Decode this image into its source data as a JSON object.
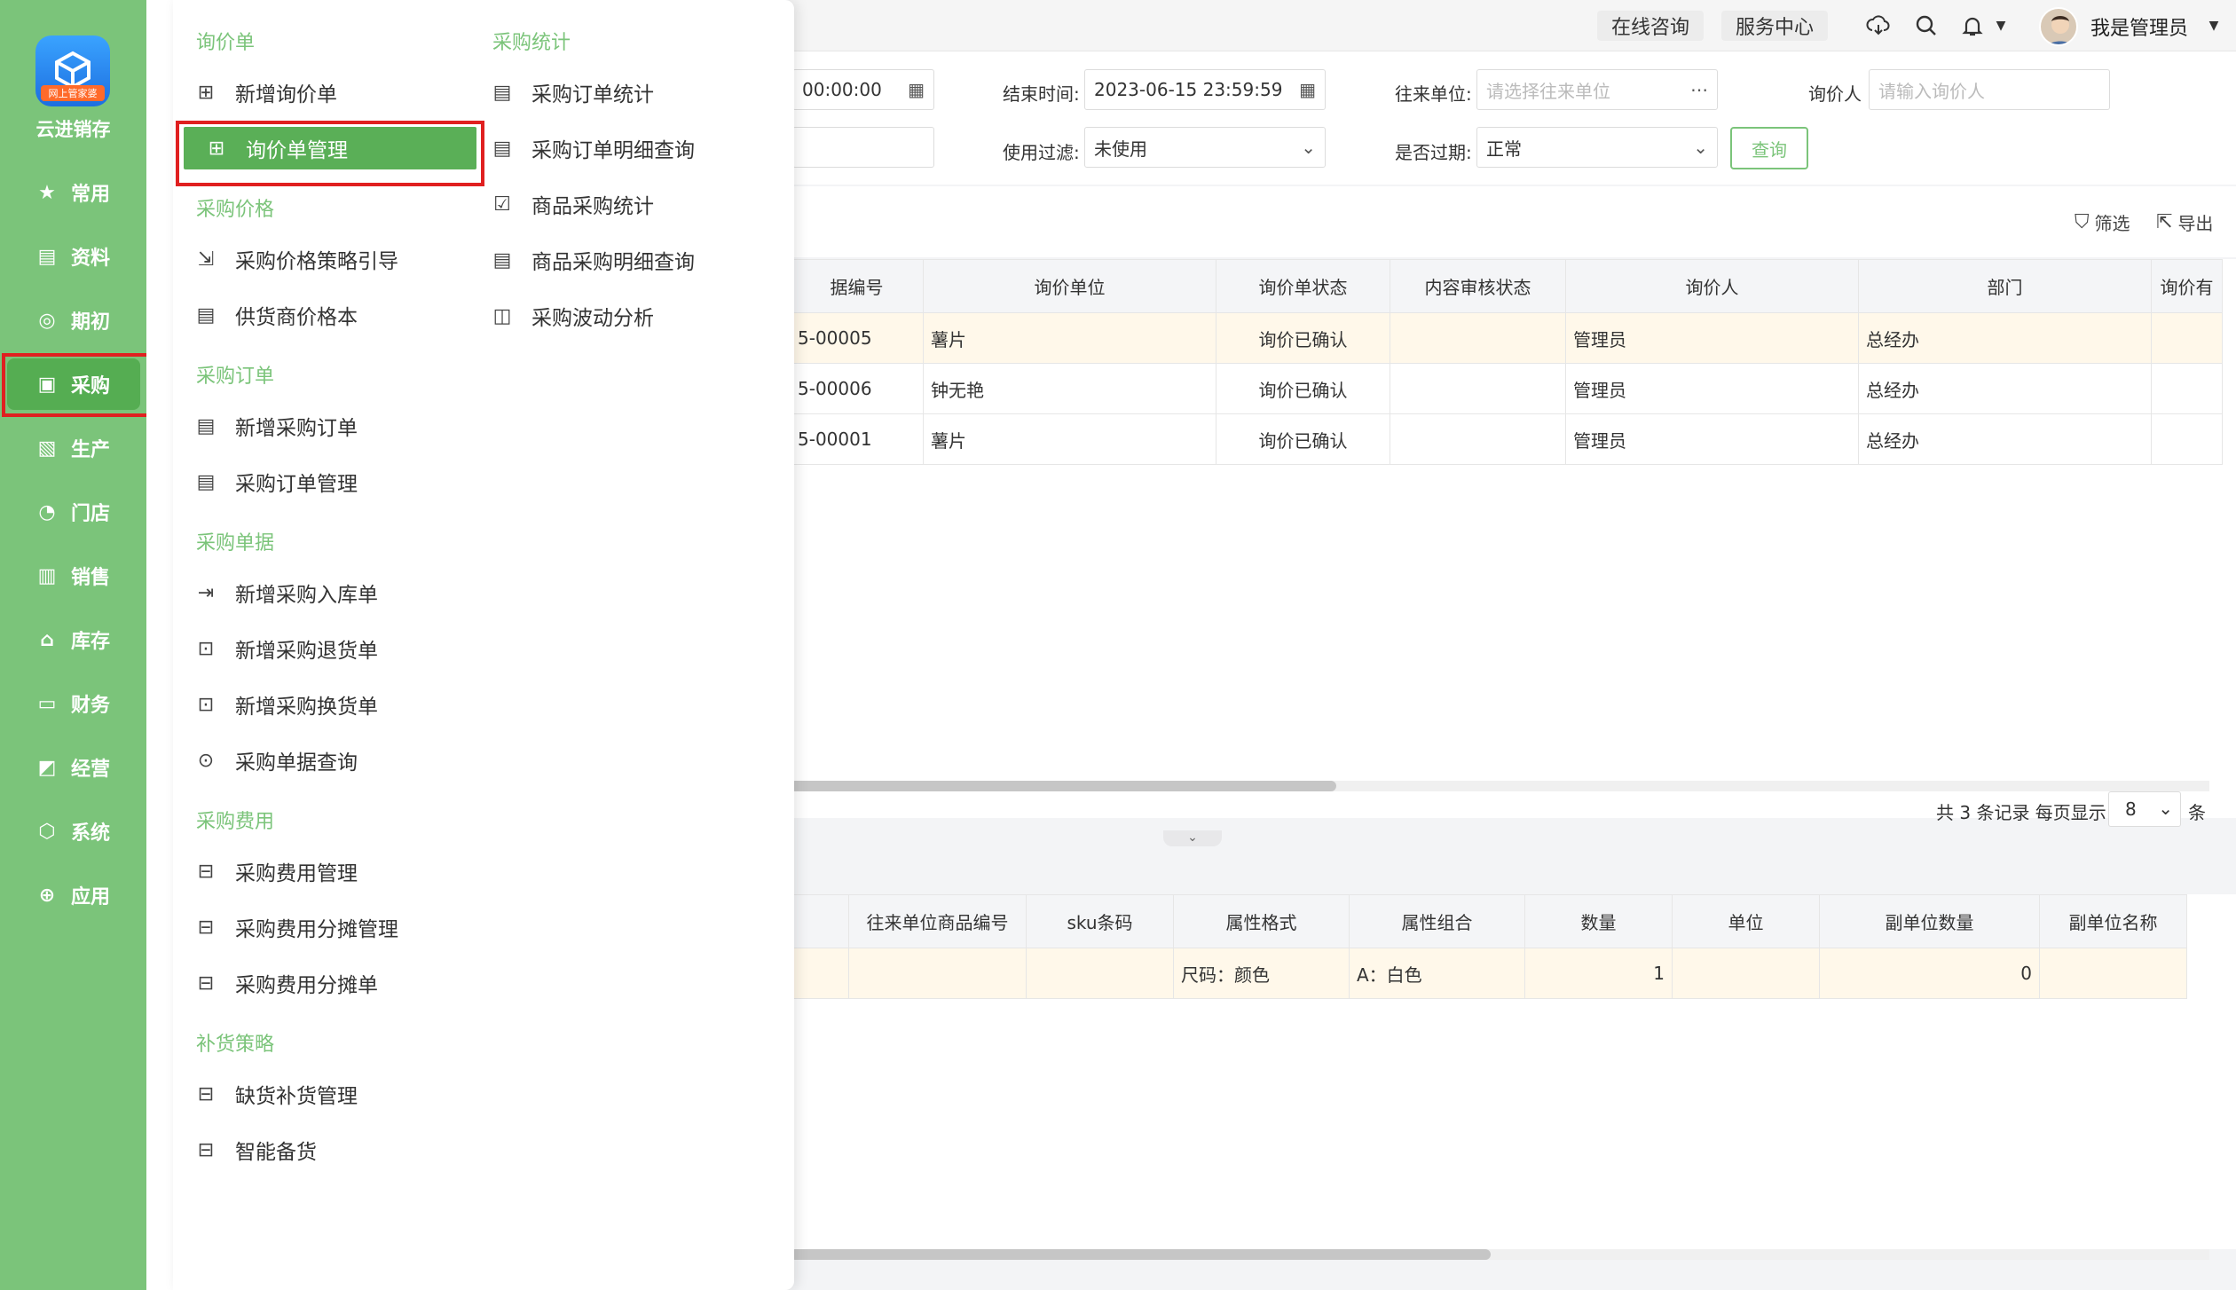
{
  "sidebar": {
    "logo_badge": "网上管家婆",
    "brand": "云进销存",
    "items": [
      {
        "label": "常用",
        "icon": "star-icon",
        "glyph": "★"
      },
      {
        "label": "资料",
        "icon": "file-icon",
        "glyph": "▤"
      },
      {
        "label": "期初",
        "icon": "target-icon",
        "glyph": "◎"
      },
      {
        "label": "采购",
        "icon": "purchase-icon",
        "glyph": "▣"
      },
      {
        "label": "生产",
        "icon": "production-icon",
        "glyph": "▧"
      },
      {
        "label": "门店",
        "icon": "store-icon",
        "glyph": "◔"
      },
      {
        "label": "销售",
        "icon": "sales-icon",
        "glyph": "▥"
      },
      {
        "label": "库存",
        "icon": "warehouse-icon",
        "glyph": "⌂"
      },
      {
        "label": "财务",
        "icon": "finance-icon",
        "glyph": "▭"
      },
      {
        "label": "经营",
        "icon": "chart-icon",
        "glyph": "◩"
      },
      {
        "label": "系统",
        "icon": "settings-icon",
        "glyph": "⬡"
      },
      {
        "label": "应用",
        "icon": "app-icon",
        "glyph": "⊕"
      }
    ]
  },
  "topbar": {
    "online_consult": "在线咨询",
    "service_center": "服务中心",
    "user_name": "我是管理员"
  },
  "filters": {
    "start_time_suffix": "00:00:00",
    "end_time_label": "结束时间:",
    "end_time_value": "2023-06-15 23:59:59",
    "partner_label": "往来单位:",
    "partner_placeholder": "请选择往来单位",
    "inquirer_label": "询价人",
    "inquirer_placeholder": "请输入询价人",
    "use_filter_label": "使用过滤:",
    "use_filter_value": "未使用",
    "expired_label": "是否过期:",
    "expired_value": "正常",
    "query_button": "查询"
  },
  "toolbar": {
    "filter": "筛选",
    "export": "导出"
  },
  "main_table": {
    "headers": [
      "据编号",
      "询价单位",
      "询价单状态",
      "内容审核状态",
      "询价人",
      "部门",
      "询价有"
    ],
    "rows": [
      [
        "5-00005",
        "薯片",
        "询价已确认",
        "",
        "管理员",
        "总经办",
        ""
      ],
      [
        "5-00006",
        "钟无艳",
        "询价已确认",
        "",
        "管理员",
        "总经办",
        ""
      ],
      [
        "5-00001",
        "薯片",
        "询价已确认",
        "",
        "管理员",
        "总经办",
        ""
      ]
    ]
  },
  "pager": {
    "summary": "共 3 条记录  每页显示",
    "page_size": "8",
    "unit": "条"
  },
  "detail_table": {
    "headers": [
      "往来单位商品编号",
      "sku条码",
      "属性格式",
      "属性组合",
      "数量",
      "单位",
      "副单位数量",
      "副单位名称"
    ],
    "row": [
      "",
      "",
      "尺码：颜色",
      "A：白色",
      "1",
      "",
      "0",
      ""
    ]
  },
  "menu": {
    "col1": [
      {
        "type": "section",
        "label": "询价单"
      },
      {
        "type": "item",
        "label": "新增询价单",
        "glyph": "⊞"
      },
      {
        "type": "item",
        "label": "询价单管理",
        "glyph": "⊞",
        "active": true
      },
      {
        "type": "section",
        "label": "采购价格"
      },
      {
        "type": "item",
        "label": "采购价格策略引导",
        "glyph": "⇲"
      },
      {
        "type": "item",
        "label": "供货商价格本",
        "glyph": "▤"
      },
      {
        "type": "section",
        "label": "采购订单"
      },
      {
        "type": "item",
        "label": "新增采购订单",
        "glyph": "▤"
      },
      {
        "type": "item",
        "label": "采购订单管理",
        "glyph": "▤"
      },
      {
        "type": "section",
        "label": "采购单据"
      },
      {
        "type": "item",
        "label": "新增采购入库单",
        "glyph": "⇥"
      },
      {
        "type": "item",
        "label": "新增采购退货单",
        "glyph": "⊡"
      },
      {
        "type": "item",
        "label": "新增采购换货单",
        "glyph": "⊡"
      },
      {
        "type": "item",
        "label": "采购单据查询",
        "glyph": "⊙"
      },
      {
        "type": "section",
        "label": "采购费用"
      },
      {
        "type": "item",
        "label": "采购费用管理",
        "glyph": "⊟"
      },
      {
        "type": "item",
        "label": "采购费用分摊管理",
        "glyph": "⊟"
      },
      {
        "type": "item",
        "label": "采购费用分摊单",
        "glyph": "⊟"
      },
      {
        "type": "section",
        "label": "补货策略"
      },
      {
        "type": "item",
        "label": "缺货补货管理",
        "glyph": "⊟"
      },
      {
        "type": "item",
        "label": "智能备货",
        "glyph": "⊟"
      }
    ],
    "col2": [
      {
        "type": "section",
        "label": "采购统计"
      },
      {
        "type": "item",
        "label": "采购订单统计",
        "glyph": "▤"
      },
      {
        "type": "item",
        "label": "采购订单明细查询",
        "glyph": "▤"
      },
      {
        "type": "item",
        "label": "商品采购统计",
        "glyph": "☑"
      },
      {
        "type": "item",
        "label": "商品采购明细查询",
        "glyph": "▤"
      },
      {
        "type": "item",
        "label": "采购波动分析",
        "glyph": "◫"
      }
    ]
  },
  "colors": {
    "sidebar_green": "#7bc47a",
    "active_green": "#5aaf57",
    "highlight_red": "#e02020"
  }
}
